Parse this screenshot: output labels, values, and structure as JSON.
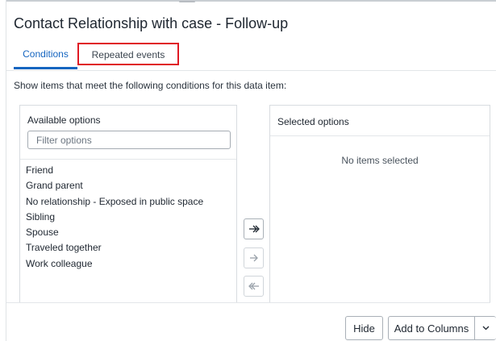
{
  "dialog": {
    "title": "Contact Relationship with case - Follow-up"
  },
  "tabs": [
    {
      "label": "Conditions",
      "active": true
    },
    {
      "label": "Repeated events",
      "active": false,
      "highlighted": true
    }
  ],
  "description": "Show items that meet the following conditions for this data item:",
  "available": {
    "title": "Available options",
    "filter_placeholder": "Filter options",
    "filter_value": "",
    "items": [
      "Friend",
      "Grand parent",
      "No relationship - Exposed in public space",
      "Sibling",
      "Spouse",
      "Traveled together",
      "Work colleague"
    ]
  },
  "transfer_buttons": {
    "add_all_icon": "double-arrow-right-icon",
    "add_icon": "arrow-right-icon",
    "remove_all_icon": "double-arrow-left-icon"
  },
  "selected": {
    "title": "Selected options",
    "empty_text": "No items selected"
  },
  "footer": {
    "hide_label": "Hide",
    "add_columns_label": "Add to Columns",
    "dropdown_icon": "chevron-down-icon"
  },
  "colors": {
    "accent": "#1565c0",
    "highlight_box": "#e01923"
  }
}
